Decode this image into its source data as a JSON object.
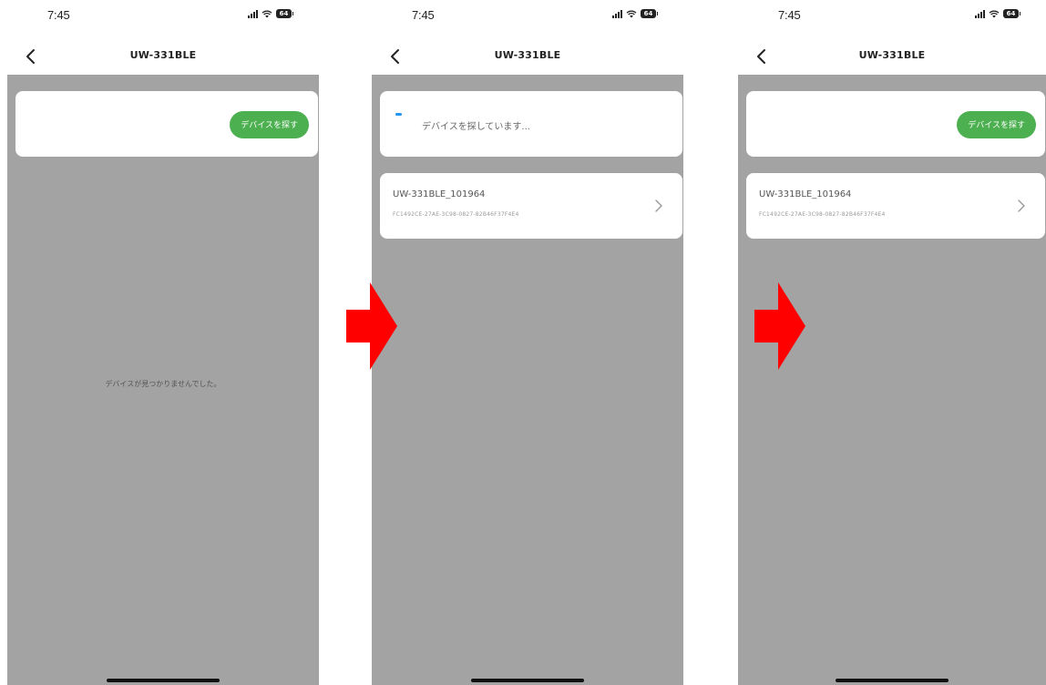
{
  "status_bar": {
    "time": "7:45",
    "battery": "64"
  },
  "nav": {
    "title": "UW-331BLE"
  },
  "screens": [
    {
      "id": "no-device",
      "scan_button": "デバイスを探す",
      "empty_message": "デバイスが見つかりませんでした。"
    },
    {
      "id": "searching",
      "searching_text": "デバイスを探しています...",
      "device": {
        "name": "UW-331BLE_101964",
        "uuid": "FC1492CE-27AE-3C98-0827-82B46F37F4E4"
      }
    },
    {
      "id": "found",
      "scan_button": "デバイスを探す",
      "device": {
        "name": "UW-331BLE_101964",
        "uuid": "FC1492CE-27AE-3C98-0827-82B46F37F4E4"
      }
    }
  ],
  "icons": {
    "back": "chevron-left-icon",
    "chevron": "chevron-right-icon",
    "signal": "signal-icon",
    "wifi": "wifi-icon",
    "battery": "battery-icon",
    "arrow": "right-arrow-icon"
  },
  "colors": {
    "accent_green": "#4caf50",
    "spinner_blue": "#2196f3",
    "overlay_gray": "#a3a3a3",
    "arrow_red": "#ff0000"
  }
}
